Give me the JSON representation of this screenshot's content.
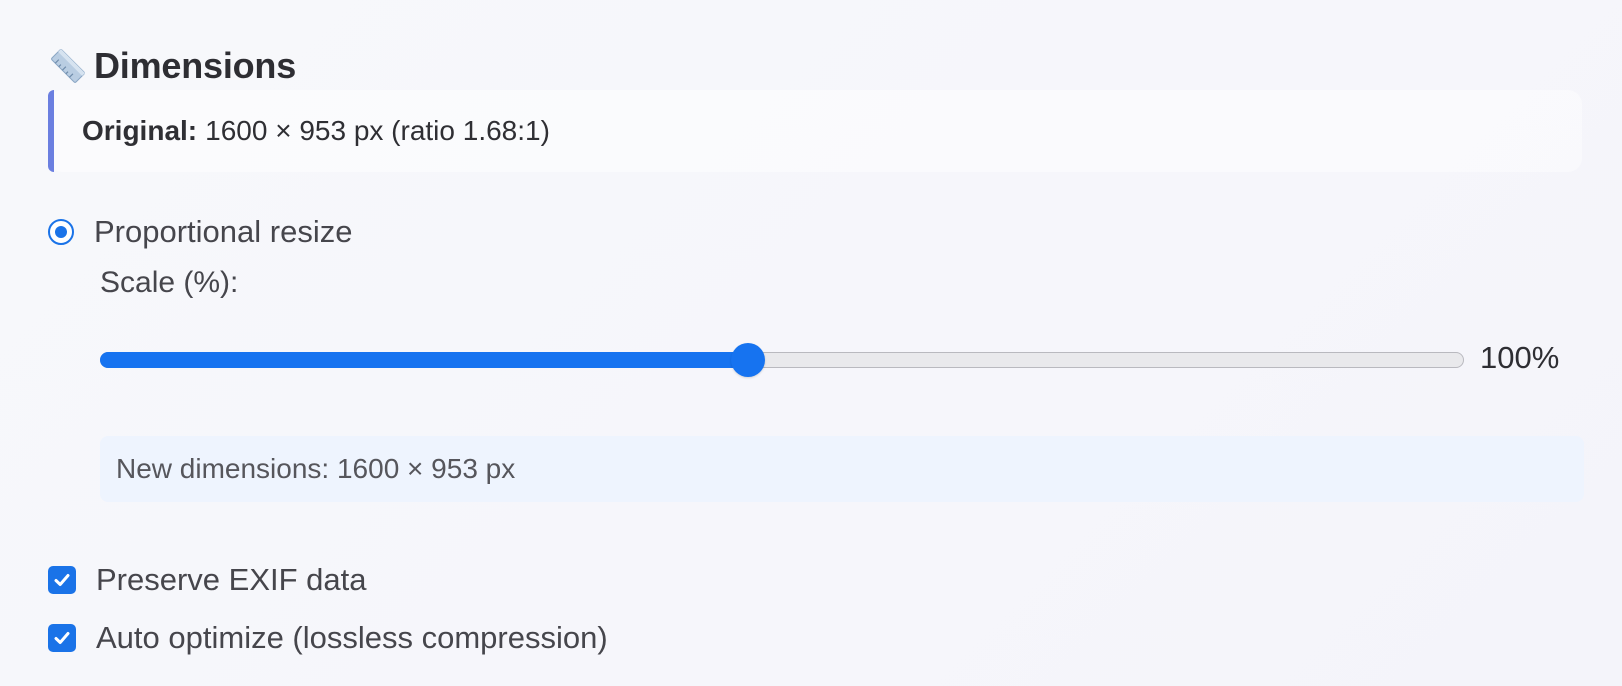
{
  "section": {
    "title": "Dimensions",
    "icon": "ruler-icon"
  },
  "original": {
    "label": "Original:",
    "value": "1600 × 953 px (ratio 1.68:1)"
  },
  "resize_mode": {
    "label": "Proportional resize",
    "selected": true
  },
  "scale": {
    "label": "Scale (%):",
    "value_text": "100%",
    "fraction": 0.475
  },
  "new_dimensions": {
    "text": "New dimensions: 1600 × 953 px"
  },
  "options": {
    "preserve_exif": {
      "label": "Preserve EXIF data",
      "checked": true
    },
    "auto_optimize": {
      "label": "Auto optimize (lossless compression)",
      "checked": true
    }
  },
  "colors": {
    "accent": "#1a73e8",
    "card_border": "#6b7fe0",
    "new_dims_bg": "#eef4fe"
  }
}
